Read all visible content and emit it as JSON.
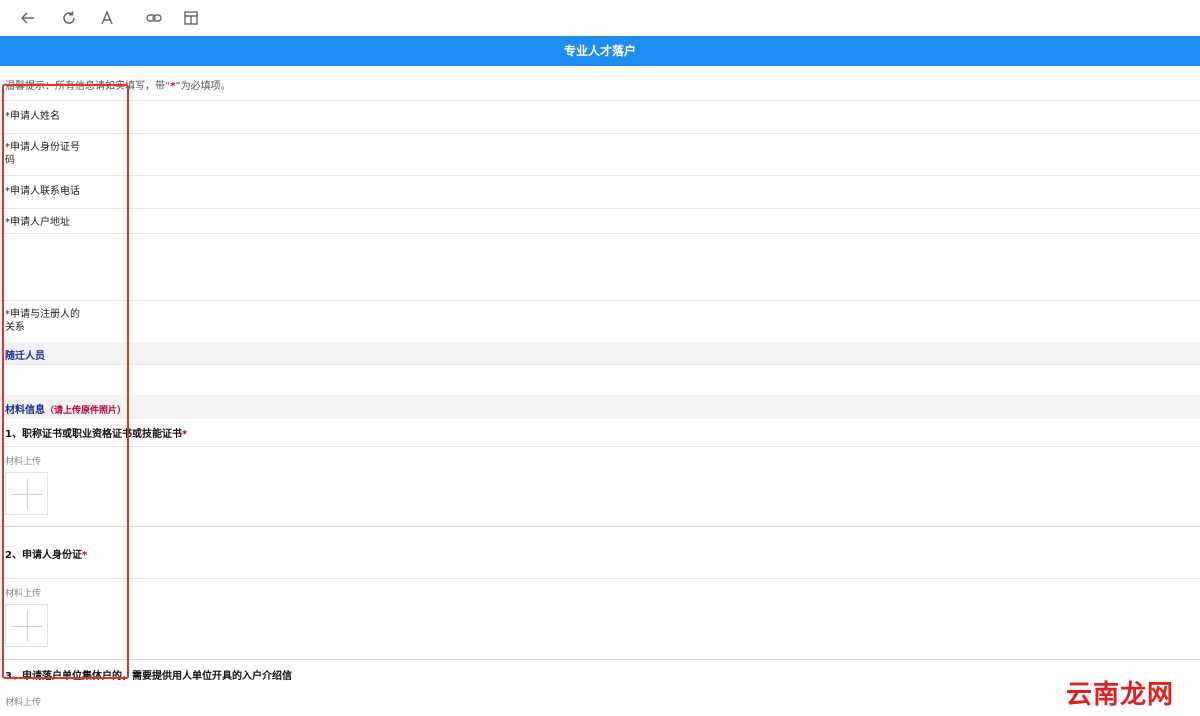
{
  "toolbar": {
    "icons": [
      "back-icon",
      "refresh-icon",
      "font-icon",
      "link-icon",
      "layout-icon"
    ]
  },
  "header": {
    "title": "专业人才落户"
  },
  "notice": {
    "prefix": "温馨提示：所有信息请如实填写，带“",
    "required_mark": "*",
    "suffix": "”为必填项。"
  },
  "form": {
    "fields": [
      {
        "label": "*申请人姓名"
      },
      {
        "label": "*申请人身份证号码"
      },
      {
        "label": "*申请人联系电话"
      },
      {
        "label": "*申请人户地址"
      },
      {
        "label": "*申请与注册人的关系"
      }
    ]
  },
  "sections": {
    "migrants": {
      "title": "随迁人员"
    },
    "materials": {
      "title": "材料信息",
      "hint": "（请上传原件照片）"
    }
  },
  "materials": {
    "upload_label": "材料上传",
    "items": [
      {
        "title": "1、职称证书或职业资格证书或技能证书",
        "required": "*"
      },
      {
        "title": "2、申请人身份证",
        "required": "*"
      },
      {
        "title": "3、申请落户单位集体户的，需要提供用人单位开具的入户介绍信",
        "required": ""
      }
    ]
  },
  "watermark": {
    "text": "云南龙网"
  },
  "colors": {
    "brand": "#1e8cf0",
    "required": "#d00000",
    "section": "#1a2a9a",
    "highlight": "#e53030"
  }
}
